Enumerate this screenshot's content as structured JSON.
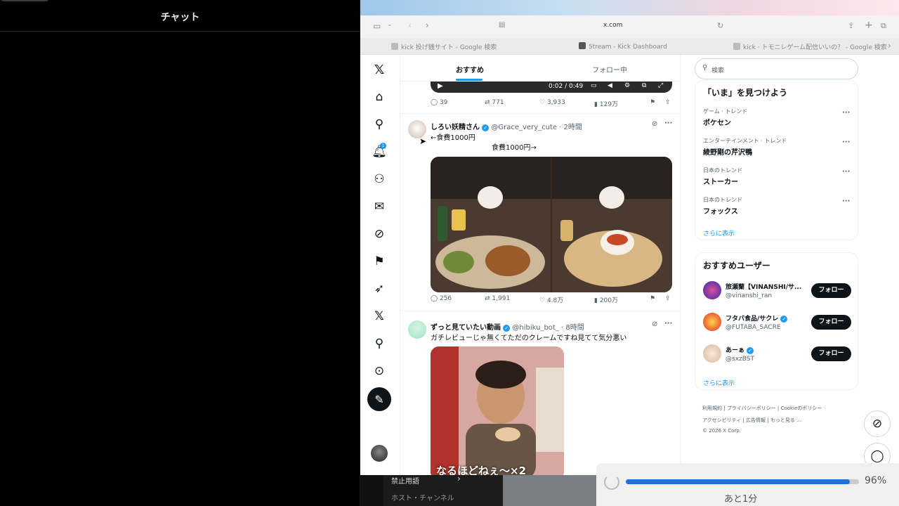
{
  "chat": {
    "title": "チャット"
  },
  "browser": {
    "url": "x.com",
    "tabs": [
      {
        "label": "kick 投げ銭サイト - Google 検索"
      },
      {
        "label": "Stream - Kick Dashboard"
      },
      {
        "label": "kick · トモニレゲーム配信いいの？ - Google 検索"
      }
    ]
  },
  "feed": {
    "tabs": [
      {
        "label": "おすすめ"
      },
      {
        "label": "フォロー中"
      }
    ],
    "video_time": "0:02 / 0:49",
    "tweets": [
      {
        "stats": {
          "replies": "39",
          "retweets": "771",
          "likes": "3,933",
          "views": "129万"
        }
      },
      {
        "name": "しろい妖精さん",
        "handle": "@Grace_very_cute · 2時間",
        "line1": "←食費1000円",
        "line2": "食費1000円→",
        "stats": {
          "replies": "256",
          "retweets": "1,991",
          "likes": "4.8万",
          "views": "200万"
        }
      },
      {
        "name": "ずっと見ていたい動画",
        "handle": "@hibiku_bot_ · 8時間",
        "text": "ガチレビューじゃ無くてただのクレームですね見てて気分悪い",
        "caption": "なるほどねぇ〜×2"
      }
    ]
  },
  "sidebar": {
    "search_placeholder": "検索",
    "trends_title": "「いま」を見つけよう",
    "trends": [
      {
        "category": "ゲーム · トレンド",
        "name": "ポケセン"
      },
      {
        "category": "エンターテインメント · トレンド",
        "name": "綾野剛の芹沢鴨"
      },
      {
        "category": "日本のトレンド",
        "name": "ストーカー"
      },
      {
        "category": "日本のトレンド",
        "name": "フォックス"
      }
    ],
    "show_more": "さらに表示",
    "who_to_follow_title": "おすすめユーザー",
    "users": [
      {
        "name": "旅瀬蘭【VINANSHI/サ...",
        "handle": "@vinanshi_ran",
        "follow": "フォロー"
      },
      {
        "name": "フタバ食品/サクレ",
        "handle": "@FUTABA_SACRE",
        "follow": "フォロー"
      },
      {
        "name": "あーぁ",
        "handle": "@sxzBST",
        "follow": "フォロー"
      }
    ],
    "footer": {
      "row1": [
        "利用規約",
        "プライバシーポリシー",
        "Cookieのポリシー"
      ],
      "row2": [
        "アクセシビリティ",
        "広告情報",
        "もっと見る …"
      ],
      "copyright": "© 2026 X Corp."
    }
  },
  "notifications_badge": "1",
  "bottom": {
    "item1": "禁止用語",
    "item2": "ホスト・チャンネル"
  },
  "download": {
    "percent_label": "96%",
    "progress": 0.96,
    "remaining": "あと1分"
  }
}
